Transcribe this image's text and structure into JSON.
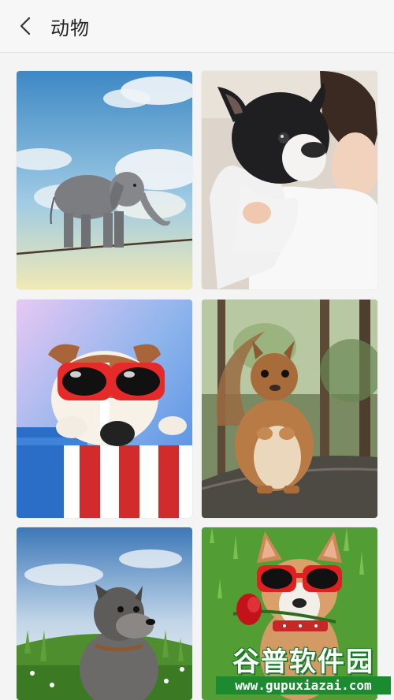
{
  "header": {
    "title": "动物"
  },
  "tiles": [
    {
      "subject": "elephant on tightrope"
    },
    {
      "subject": "french bulldog with woman"
    },
    {
      "subject": "dog with red sunglasses on striped chair"
    },
    {
      "subject": "squirrel"
    },
    {
      "subject": "schnauzer in grass"
    },
    {
      "subject": "chihuahua with sunglasses and rose"
    }
  ],
  "watermark": {
    "main": "谷普软件园",
    "url": "www.gupuxiazai.com"
  },
  "colors": {
    "header_bg": "#f7f7f7",
    "page_bg": "#f4f4f4",
    "watermark_green": "#1c8a2e"
  }
}
